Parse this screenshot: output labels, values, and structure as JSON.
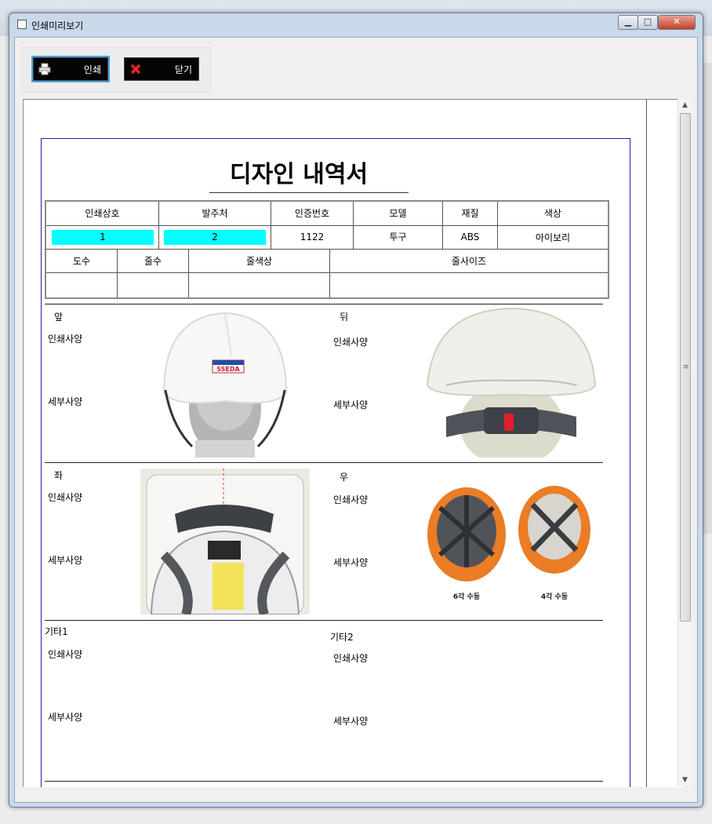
{
  "window": {
    "title": "인쇄미리보기"
  },
  "toolbar": {
    "print_label": "인쇄",
    "close_label": "닫기"
  },
  "document": {
    "title": "디자인 내역서",
    "header_row1": [
      "인쇄상호",
      "발주처",
      "인증번호",
      "모델",
      "재질",
      "색상"
    ],
    "values_row1": [
      "1",
      "2",
      "1122",
      "투구",
      "ABS",
      "아이보리"
    ],
    "header_row2": [
      "도수",
      "줄수",
      "줄색상",
      "줄사이즈"
    ],
    "values_row2": [
      "",
      "",
      "",
      ""
    ],
    "sections": {
      "front": "앞",
      "back": "뒤",
      "left": "좌",
      "right": "우",
      "etc1": "기타1",
      "etc2": "기타2",
      "print_spec": "인쇄사양",
      "detail_spec": "세부사양"
    },
    "photo_captions": [
      "6각 수동",
      "4각 수동"
    ],
    "logo_text": "SSEDA"
  }
}
